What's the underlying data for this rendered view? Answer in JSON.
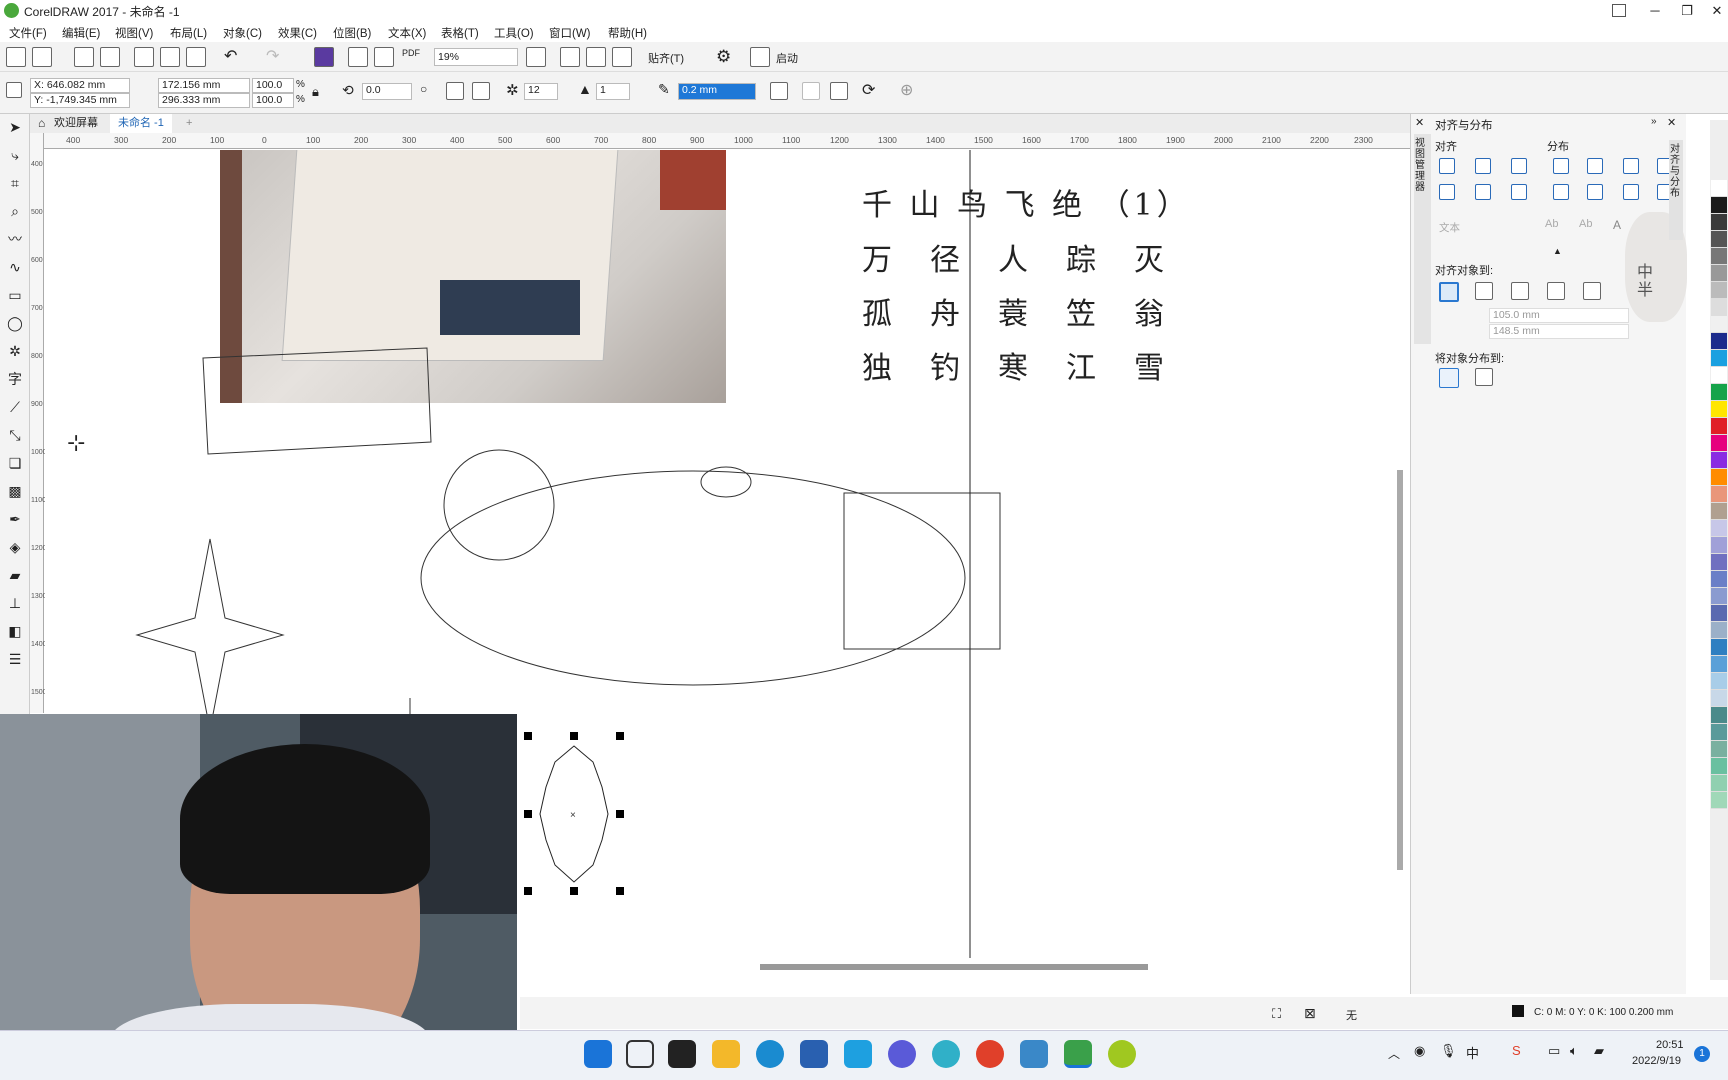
{
  "window": {
    "title": "CorelDRAW 2017 - 未命名 -1",
    "min": "─",
    "max": "❐",
    "close": "✕"
  },
  "menu": [
    "文件(F)",
    "编辑(E)",
    "视图(V)",
    "布局(L)",
    "对象(C)",
    "效果(C)",
    "位图(B)",
    "文本(X)",
    "表格(T)",
    "工具(O)",
    "窗口(W)",
    "帮助(H)"
  ],
  "toolbar": {
    "zoom_value": "19%",
    "snap_label": "贴齐(T)",
    "launch_label": "启动",
    "pdf_label": "PDF"
  },
  "propbar": {
    "x": "X: 646.082 mm",
    "y": "Y: -1,749.345 mm",
    "width": "172.156 mm",
    "height": "296.333 mm",
    "scale_w": "100.0",
    "scale_h": "100.0",
    "pct": "%",
    "rotation": "0.0",
    "points": "12",
    "sharpness": "1",
    "outline": "0.2 mm"
  },
  "doctabs": {
    "welcome": "欢迎屏幕",
    "doc": "未命名 -1",
    "add": "+"
  },
  "ruler_h": [
    "400",
    "300",
    "200",
    "100",
    "0",
    "100",
    "200",
    "300",
    "400",
    "500",
    "600",
    "700",
    "800",
    "900",
    "1000",
    "1100",
    "1200",
    "1300",
    "1400",
    "1500",
    "1600",
    "1700",
    "1800",
    "1900",
    "2000",
    "2100",
    "2200",
    "2300"
  ],
  "ruler_v": [
    "400",
    "500",
    "600",
    "700",
    "800",
    "900",
    "1000",
    "1100",
    "1200",
    "1300",
    "1400",
    "1500"
  ],
  "poem": {
    "title": "千 山 鸟 飞 绝 （1）",
    "lines": [
      "万　径　人　踪　灭",
      "孤　舟　蓑　笠　翁",
      "独　钓　寒　江　雪"
    ]
  },
  "docker": {
    "title": "对齐与分布",
    "align": "对齐",
    "distribute": "分布",
    "text_label": "文本",
    "align_to": "对齐对象到:",
    "x_value": "105.0 mm",
    "y_value": "148.5 mm",
    "distribute_to": "将对象分布到:",
    "side_tabs": [
      "对齐与分布",
      "视图管理器"
    ],
    "sticker": "中半"
  },
  "status": {
    "fill": "无",
    "outline_info": "C: 0 M: 0 Y: 0 K: 100  0.200 mm"
  },
  "taskbar": {
    "time": "20:51",
    "date": "2022/9/19",
    "notif": "1"
  },
  "palette": [
    "#ffffff",
    "#1a1a1a",
    "#3a3a3a",
    "#555555",
    "#777777",
    "#999999",
    "#bbbbbb",
    "#dddddd",
    "#f0f0f0",
    "#1c2b8c",
    "#1aa0e0",
    "#ffffff",
    "#16a34a",
    "#ffe600",
    "#e01f26",
    "#e6007e",
    "#8a2be2",
    "#ff8c00",
    "#e9967a",
    "#b0a090",
    "#c7c7e8",
    "#a0a0d8",
    "#7070c0",
    "#6a7fc7",
    "#8a9bd0",
    "#5a6ab0",
    "#9bb0c8",
    "#2f7fc1",
    "#5ba0d8",
    "#a8cde8",
    "#c8d8e8",
    "#4a8a8a",
    "#5a9a9a",
    "#7ab0a0",
    "#6ac0a0",
    "#90d0b0",
    "#a0d8b8"
  ],
  "colors": {
    "accent": "#1e78d7",
    "chrome": "#f3f3f3"
  }
}
